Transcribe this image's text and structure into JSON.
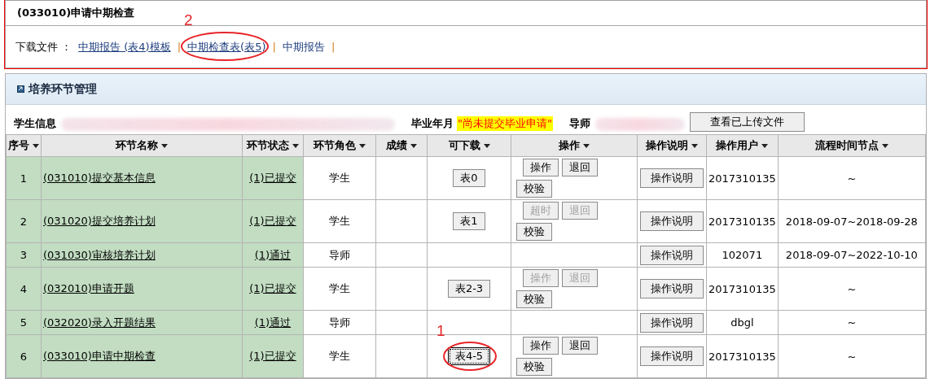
{
  "task_panel": {
    "title": "(033010)申请中期检查",
    "download_label": "下载文件 ：",
    "links": [
      {
        "label": "中期报告 (表4)模板",
        "underlined": true,
        "separator": "|"
      },
      {
        "label": "中期检查表(表5)",
        "underlined": true,
        "separator": "|",
        "annotation": "2"
      },
      {
        "label": "中期报告",
        "underlined": false,
        "separator": "|"
      }
    ]
  },
  "section": {
    "title": "培养环节管理",
    "info": {
      "student_label": "学生信息",
      "graduation_label": "毕业年月",
      "graduation_value": "\"尚未提交毕业申请\"",
      "advisor_label": "导师",
      "view_button": "查看已上传文件"
    },
    "table": {
      "columns": [
        "序号",
        "环节名称",
        "环节状态",
        "环节角色",
        "成绩",
        "可下载",
        "操作",
        "操作说明",
        "操作用户",
        "流程时间节点"
      ],
      "rows": [
        {
          "index": "1",
          "name": "(031010)提交基本信息",
          "status": "(1)已提交",
          "role": "学生",
          "download": {
            "label": "表0",
            "selected": false
          },
          "ops": [
            {
              "label": "操作",
              "disabled": false
            },
            {
              "label": "退回",
              "disabled": false
            },
            {
              "label": "校验",
              "disabled": false
            }
          ],
          "help": "操作说明",
          "user": "2017310135",
          "period": "~"
        },
        {
          "index": "2",
          "name": "(031020)提交培养计划",
          "status": "(1)已提交",
          "role": "学生",
          "download": {
            "label": "表1",
            "selected": false
          },
          "ops": [
            {
              "label": "超时",
              "disabled": true
            },
            {
              "label": "退回",
              "disabled": true
            },
            {
              "label": "校验",
              "disabled": false
            }
          ],
          "help": "操作说明",
          "user": "2017310135",
          "period": "2018-09-07~2018-09-28"
        },
        {
          "index": "3",
          "name": "(031030)审核培养计划",
          "status": "(1)通过",
          "role": "导师",
          "help": "操作说明",
          "user": "102071",
          "period": "2018-09-07~2022-10-10"
        },
        {
          "index": "4",
          "name": "(032010)申请开题",
          "status": "(1)已提交",
          "role": "学生",
          "download": {
            "label": "表2-3",
            "selected": false
          },
          "ops": [
            {
              "label": "操作",
              "disabled": true
            },
            {
              "label": "退回",
              "disabled": true
            },
            {
              "label": "校验",
              "disabled": false
            }
          ],
          "help": "操作说明",
          "user": "2017310135",
          "period": "~"
        },
        {
          "index": "5",
          "name": "(032020)录入开题结果",
          "status": "(1)通过",
          "role": "导师",
          "help": "操作说明",
          "user": "dbgl",
          "period": "~"
        },
        {
          "index": "6",
          "name": "(033010)申请中期检查",
          "status": "(1)已提交",
          "role": "学生",
          "download": {
            "label": "表4-5",
            "selected": true,
            "annotation": "1"
          },
          "ops": [
            {
              "label": "操作",
              "disabled": false
            },
            {
              "label": "退回",
              "disabled": false
            },
            {
              "label": "校验",
              "disabled": false
            }
          ],
          "help": "操作说明",
          "user": "2017310135",
          "period": "~"
        }
      ]
    }
  }
}
